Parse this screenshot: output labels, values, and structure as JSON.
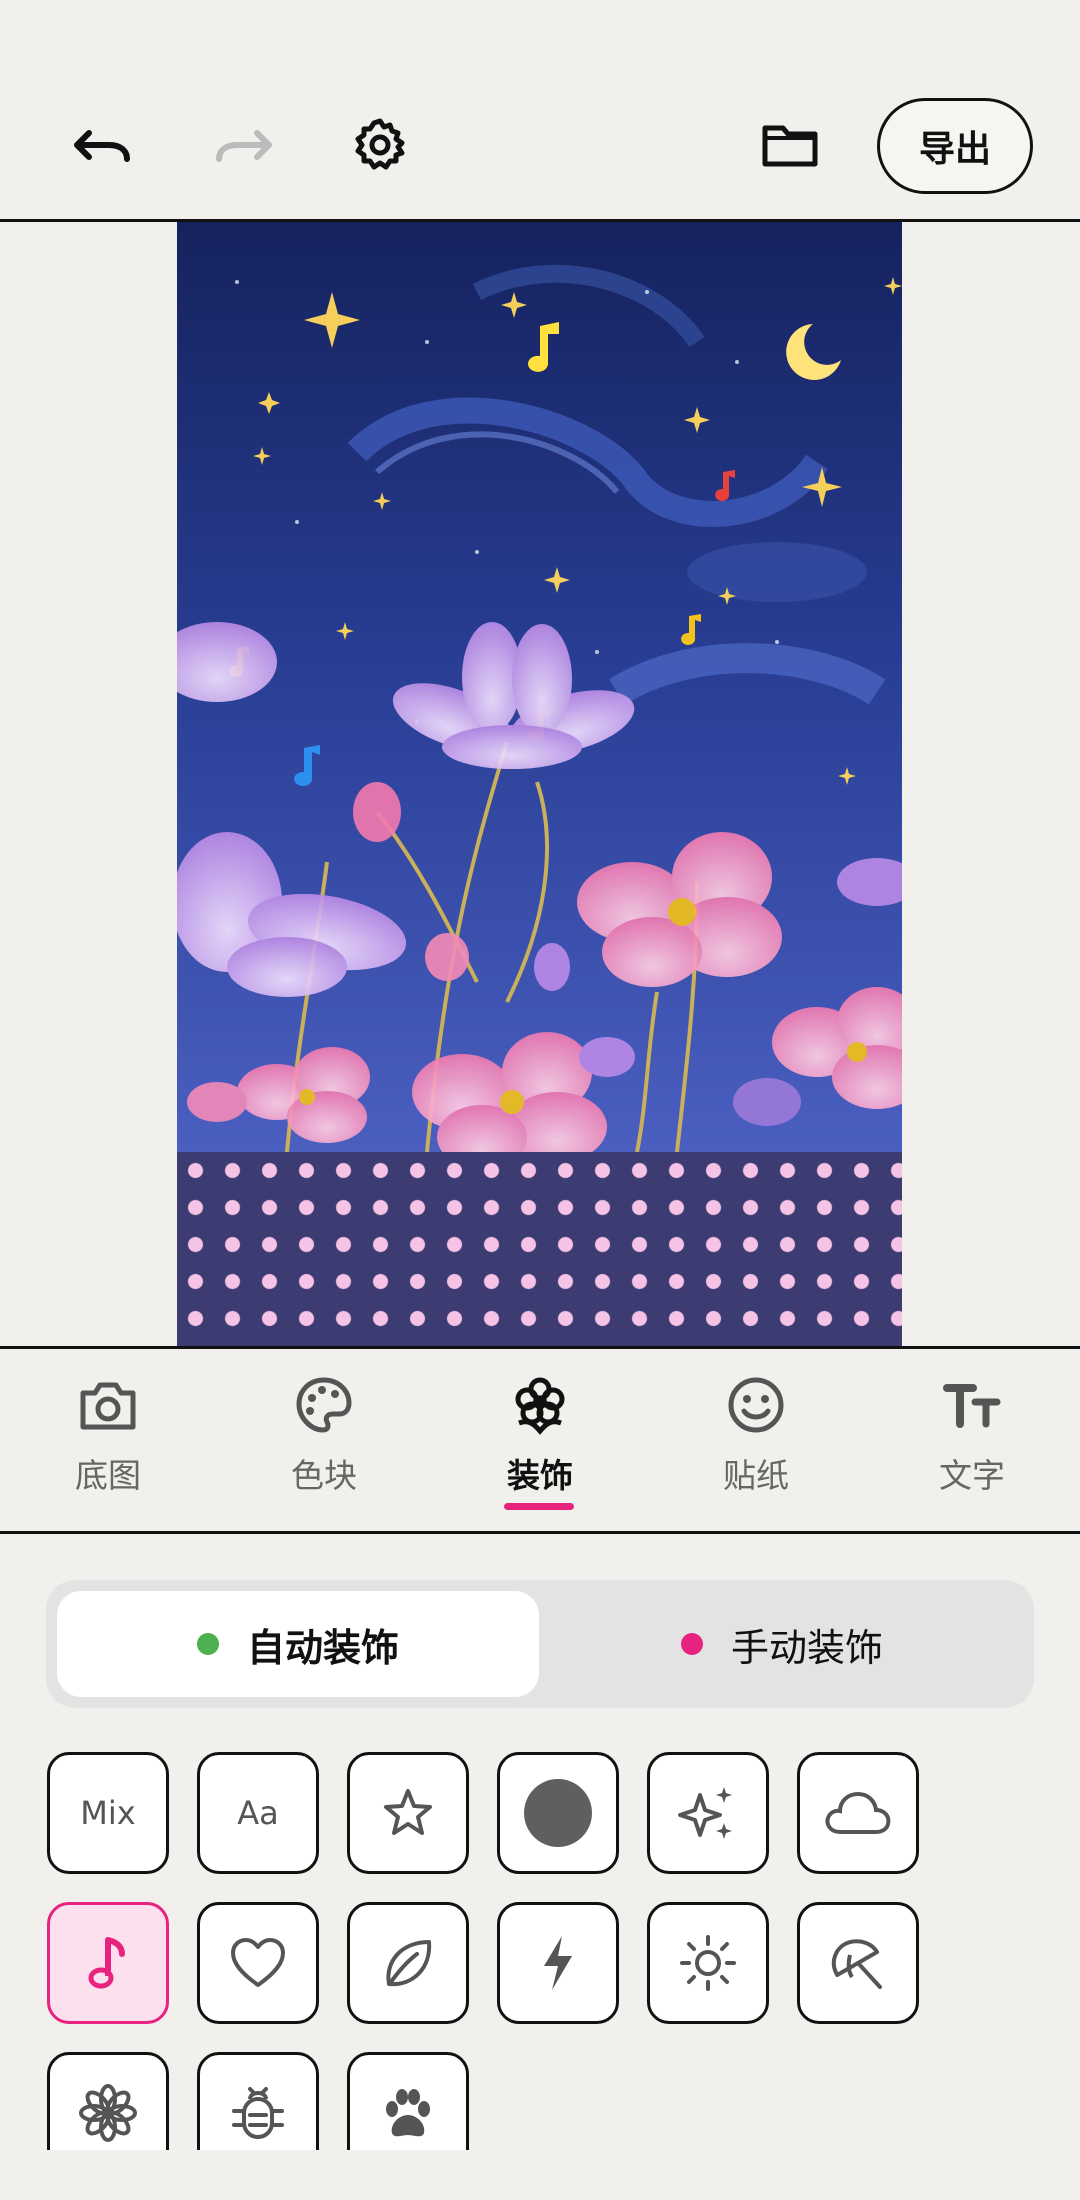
{
  "toolbar": {
    "undo_icon": "undo-icon",
    "redo_icon": "redo-icon",
    "settings_icon": "gear-icon",
    "folder_icon": "folder-icon",
    "export_label": "导出"
  },
  "tabs": [
    {
      "label": "底图",
      "icon": "camera-icon"
    },
    {
      "label": "色块",
      "icon": "palette-icon"
    },
    {
      "label": "装饰",
      "icon": "flower-icon",
      "active": true
    },
    {
      "label": "贴纸",
      "icon": "smiley-icon"
    },
    {
      "label": "文字",
      "icon": "text-size-icon"
    }
  ],
  "segment": {
    "auto_label": "自动装饰",
    "manual_label": "手动装饰",
    "auto_dot_color": "#4caf50",
    "manual_dot_color": "#e8237f"
  },
  "decorations": {
    "mix_label": "Mix",
    "aa_label": "Aa",
    "selected": "music-note"
  },
  "colors": {
    "accent": "#e8237f",
    "dot_pattern_bg": "#3c3b72",
    "dot_pattern_dot": "#f5c3e6"
  }
}
